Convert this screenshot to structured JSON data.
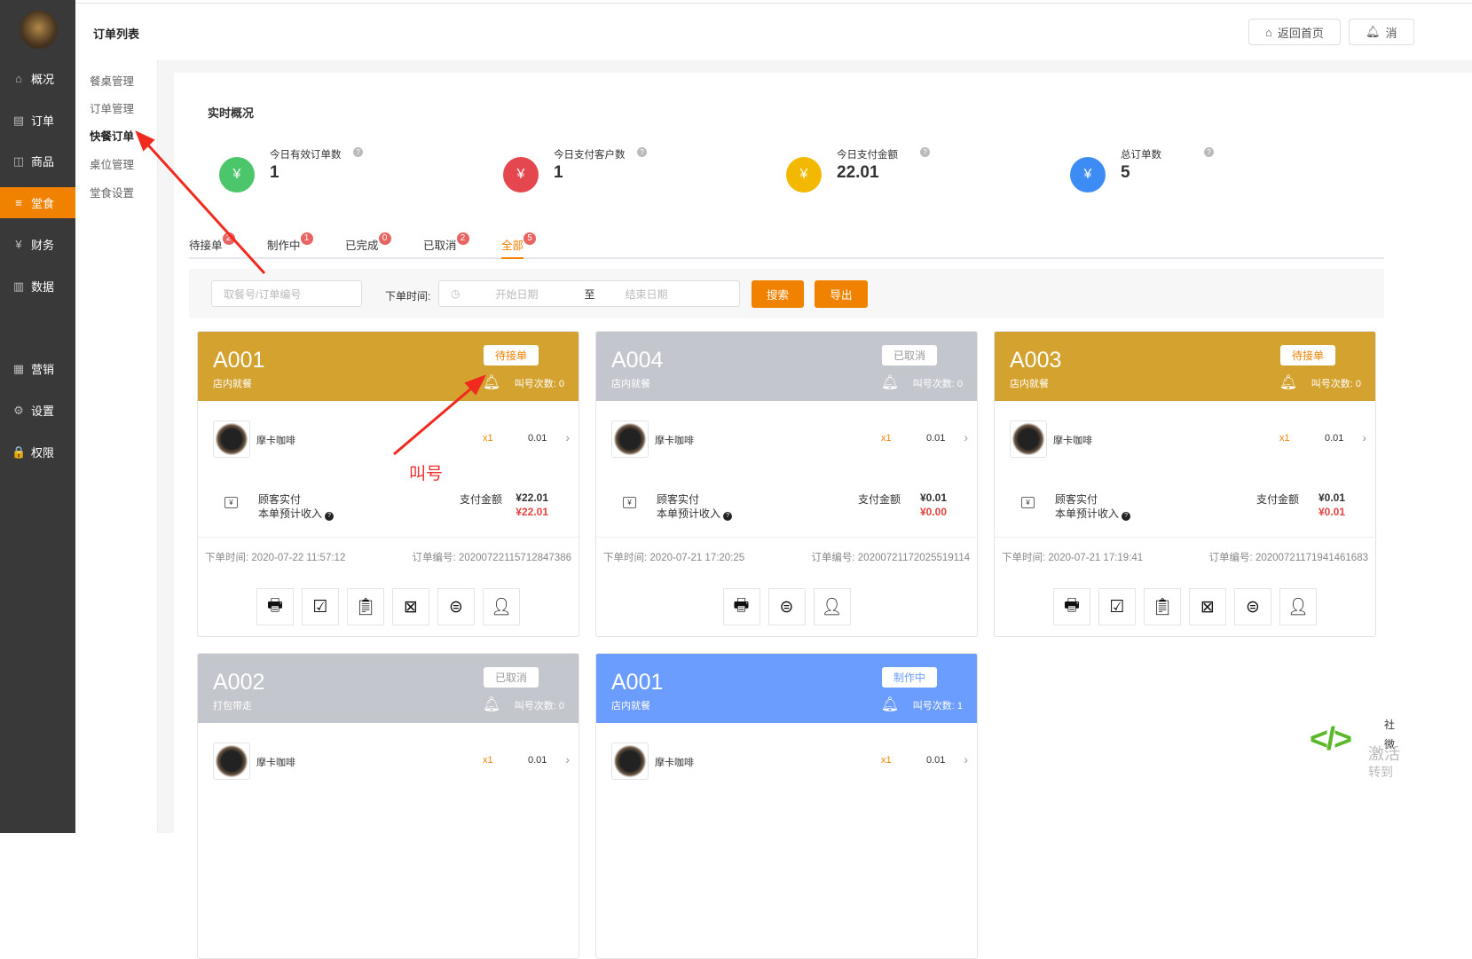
{
  "sidebar": {
    "items": [
      {
        "label": "概况",
        "icon": "⌂"
      },
      {
        "label": "订单",
        "icon": "▤"
      },
      {
        "label": "商品",
        "icon": "◫"
      },
      {
        "label": "堂食",
        "icon": "≡"
      },
      {
        "label": "财务",
        "icon": "¥"
      },
      {
        "label": "数据",
        "icon": "▥"
      },
      {
        "label": "营销",
        "icon": "▦"
      },
      {
        "label": "设置",
        "icon": "⚙"
      },
      {
        "label": "权限",
        "icon": "🔒"
      }
    ]
  },
  "header": {
    "title": "订单列表",
    "home_btn": "返回首页",
    "msg_btn": "消"
  },
  "submenu": [
    "餐桌管理",
    "订单管理",
    "快餐订单",
    "桌位管理",
    "堂食设置"
  ],
  "overview": {
    "title": "实时概况",
    "stats": [
      {
        "label": "今日有效订单数",
        "value": "1",
        "color": "#4cc66a"
      },
      {
        "label": "今日支付客户数",
        "value": "1",
        "color": "#e4474d"
      },
      {
        "label": "今日支付金额",
        "value": "22.01",
        "color": "#f3b800"
      },
      {
        "label": "总订单数",
        "value": "5",
        "color": "#3d8cf5"
      }
    ]
  },
  "tabs": [
    {
      "label": "待接单",
      "count": "2"
    },
    {
      "label": "制作中",
      "count": "1"
    },
    {
      "label": "已完成",
      "count": "0"
    },
    {
      "label": "已取消",
      "count": "2"
    },
    {
      "label": "全部",
      "count": "5"
    }
  ],
  "filter": {
    "search_placeholder": "取餐号/订单编号",
    "time_label": "下单时间:",
    "start_placeholder": "开始日期",
    "sep": "至",
    "end_placeholder": "结束日期",
    "search_btn": "搜索",
    "export_btn": "导出"
  },
  "labels": {
    "calls": "叫号次数:",
    "pay_label": "顾客实付",
    "income_label": "本单预计收入",
    "amount_label": "支付金额",
    "time_label": "下单时间:",
    "no_label": "订单编号:"
  },
  "cards": [
    {
      "table": "A001",
      "type": "店内就餐",
      "status": "待接单",
      "color": "#d4a22e",
      "calls": "0",
      "item": "摩卡咖啡",
      "qty": "x1",
      "price": "0.01",
      "paid": "¥22.01",
      "income": "¥22.01",
      "time": "2020-07-22 11:57:12",
      "no": "20200722115712847386",
      "actions": [
        "print",
        "accept",
        "order",
        "cancel-order",
        "refund",
        "user"
      ]
    },
    {
      "table": "A004",
      "type": "店内就餐",
      "status": "已取消",
      "color": "#c3c6cc",
      "calls": "0",
      "item": "摩卡咖啡",
      "qty": "x1",
      "price": "0.01",
      "paid": "¥0.01",
      "income": "¥0.00",
      "time": "2020-07-21 17:20:25",
      "no": "20200721172025519114",
      "actions": [
        "print",
        "refund",
        "user"
      ]
    },
    {
      "table": "A003",
      "type": "店内就餐",
      "status": "待接单",
      "color": "#d4a22e",
      "calls": "0",
      "item": "摩卡咖啡",
      "qty": "x1",
      "price": "0.01",
      "paid": "¥0.01",
      "income": "¥0.01",
      "time": "2020-07-21 17:19:41",
      "no": "20200721171941461683",
      "actions": [
        "print",
        "accept",
        "order",
        "cancel-order",
        "refund",
        "user"
      ]
    },
    {
      "table": "A002",
      "type": "打包带走",
      "status": "已取消",
      "color": "#c3c6cc",
      "calls": "0",
      "item": "摩卡咖啡",
      "qty": "x1",
      "price": "0.01"
    },
    {
      "table": "A001",
      "type": "店内就餐",
      "status": "制作中",
      "color": "#6b9cff",
      "calls": "1",
      "item": "摩卡咖啡",
      "qty": "x1",
      "price": "0.01"
    }
  ],
  "annotation": "叫号",
  "watermark": {
    "line1": "激活",
    "line2": "转到",
    "side1": "社",
    "side2": "微"
  }
}
